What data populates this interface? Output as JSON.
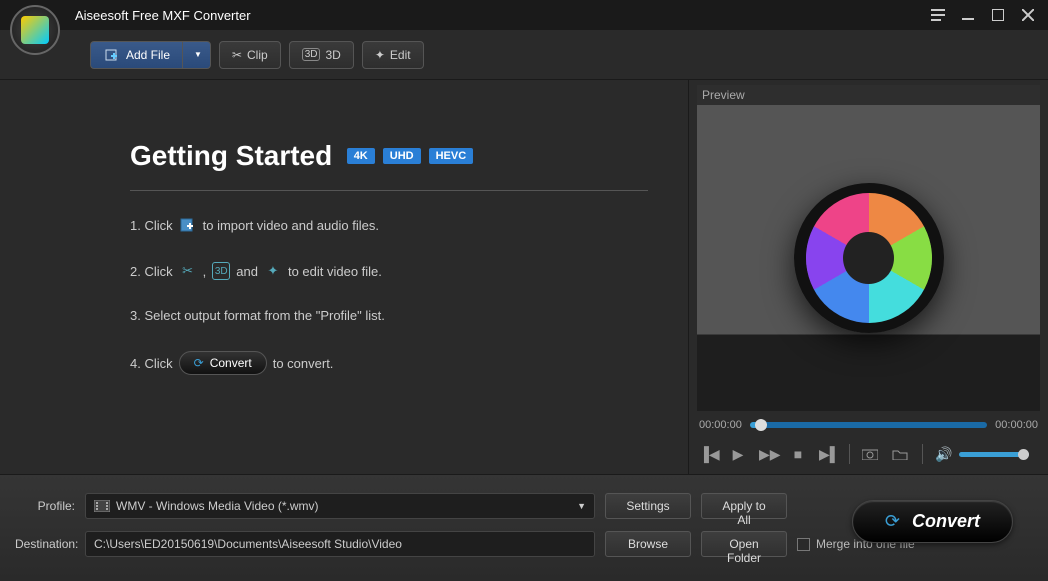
{
  "app": {
    "title": "Aiseesoft Free MXF Converter"
  },
  "toolbar": {
    "add_file": "Add File",
    "clip": "Clip",
    "threed": "3D",
    "edit": "Edit"
  },
  "getting_started": {
    "heading": "Getting Started",
    "badges": [
      "4K",
      "UHD",
      "HEVC"
    ],
    "step1_pre": "1. Click",
    "step1_post": "to import video and audio files.",
    "step2_pre": "2. Click",
    "step2_comma": ",",
    "step2_and": "and",
    "step2_post": "to edit video file.",
    "step3": "3. Select output format from the \"Profile\" list.",
    "step4_pre": "4. Click",
    "step4_btn": "Convert",
    "step4_post": "to convert."
  },
  "preview": {
    "title": "Preview",
    "time_current": "00:00:00",
    "time_total": "00:00:00"
  },
  "bottom": {
    "profile_label": "Profile:",
    "profile_value": "WMV - Windows Media Video (*.wmv)",
    "settings": "Settings",
    "apply_all": "Apply to All",
    "destination_label": "Destination:",
    "destination_value": "C:\\Users\\ED20150619\\Documents\\Aiseesoft Studio\\Video",
    "browse": "Browse",
    "open_folder": "Open Folder",
    "merge": "Merge into one file",
    "convert": "Convert"
  }
}
